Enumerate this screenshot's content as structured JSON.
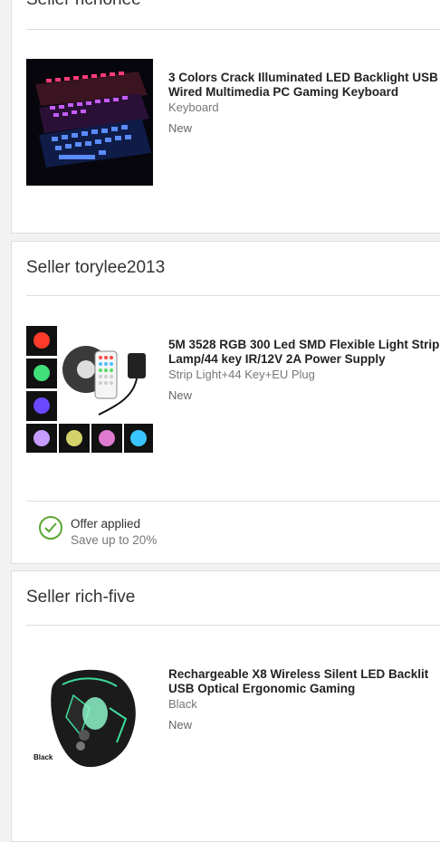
{
  "sellers": [
    {
      "name": "Seller richonee",
      "item": {
        "title": "3 Colors Crack Illuminated LED Backlight USB Wired Multimedia PC Gaming Keyboard",
        "variant": "Keyboard",
        "condition": "New",
        "image_icon": "keyboard-image"
      }
    },
    {
      "name": "Seller torylee2013",
      "item": {
        "title": "5M 3528 RGB 300 Led SMD Flexible Light Strip Lamp/44 key IR/12V 2A Power Supply",
        "variant": "Strip Light+44 Key+EU Plug",
        "condition": "New",
        "image_icon": "led-strip-image"
      },
      "offer": {
        "label": "Offer applied",
        "detail": "Save up to 20%",
        "color": "#5ba532"
      }
    },
    {
      "name": "Seller rich-five",
      "item": {
        "title": "Rechargeable X8 Wireless Silent LED Backlit USB Optical Ergonomic Gaming",
        "variant": "Black",
        "condition": "New",
        "image_icon": "gaming-mouse-image",
        "image_caption": "Black"
      }
    }
  ]
}
